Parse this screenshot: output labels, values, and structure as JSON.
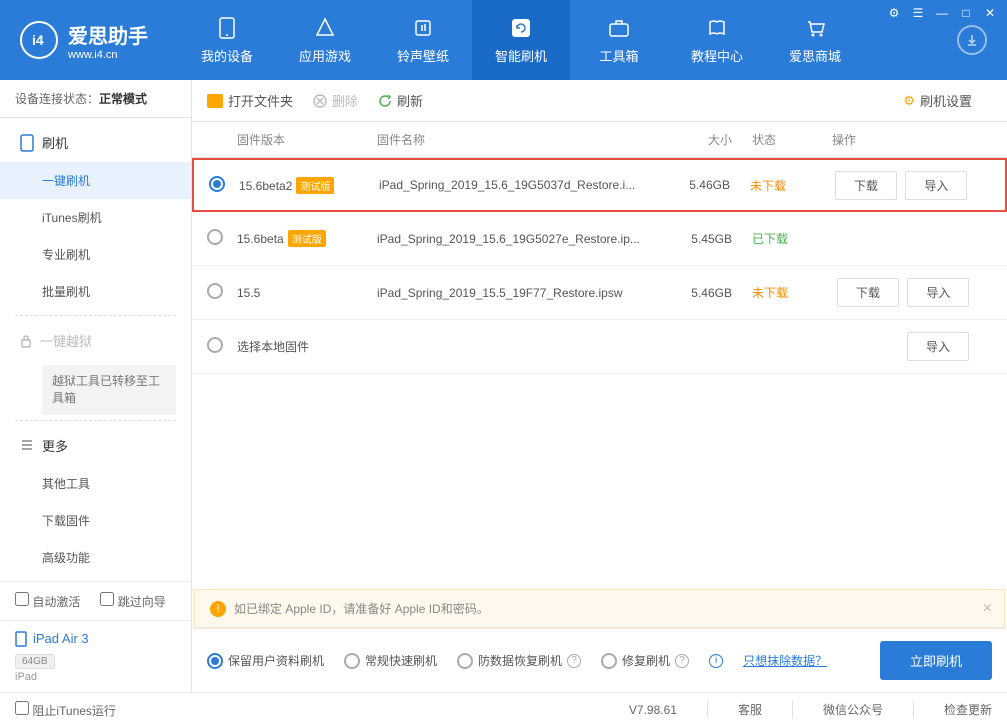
{
  "app": {
    "name": "爱思助手",
    "url": "www.i4.cn"
  },
  "nav": {
    "items": [
      {
        "label": "我的设备"
      },
      {
        "label": "应用游戏"
      },
      {
        "label": "铃声壁纸"
      },
      {
        "label": "智能刷机"
      },
      {
        "label": "工具箱"
      },
      {
        "label": "教程中心"
      },
      {
        "label": "爱思商城"
      }
    ]
  },
  "sidebar": {
    "status_label": "设备连接状态：",
    "status_value": "正常模式",
    "flash": "刷机",
    "items": {
      "oneclick": "一键刷机",
      "itunes": "iTunes刷机",
      "pro": "专业刷机",
      "batch": "批量刷机",
      "jailbreak": "一键越狱",
      "jailbreak_note": "越狱工具已转移至工具箱",
      "more": "更多",
      "other_tools": "其他工具",
      "download_fw": "下载固件",
      "advanced": "高级功能"
    },
    "auto_activate": "自动激活",
    "skip_guide": "跳过向导",
    "device": {
      "name": "iPad Air 3",
      "storage": "64GB",
      "model": "iPad"
    }
  },
  "toolbar": {
    "open_folder": "打开文件夹",
    "delete": "删除",
    "refresh": "刷新",
    "settings": "刷机设置"
  },
  "table": {
    "headers": {
      "version": "固件版本",
      "name": "固件名称",
      "size": "大小",
      "status": "状态",
      "action": "操作"
    },
    "rows": [
      {
        "version": "15.6beta2",
        "beta": "测试版",
        "name": "iPad_Spring_2019_15.6_19G5037d_Restore.i...",
        "size": "5.46GB",
        "status": "未下载",
        "status_class": "orange",
        "selected": true,
        "highlighted": true,
        "download": "下载",
        "import": "导入"
      },
      {
        "version": "15.6beta",
        "beta": "测试版",
        "name": "iPad_Spring_2019_15.6_19G5027e_Restore.ip...",
        "size": "5.45GB",
        "status": "已下载",
        "status_class": "green",
        "selected": false
      },
      {
        "version": "15.5",
        "name": "iPad_Spring_2019_15.5_19F77_Restore.ipsw",
        "size": "5.46GB",
        "status": "未下载",
        "status_class": "orange",
        "selected": false,
        "download": "下载",
        "import": "导入"
      },
      {
        "version": "",
        "name_alt": "选择本地固件",
        "import": "导入"
      }
    ]
  },
  "notice": "如已绑定 Apple ID，请准备好 Apple ID和密码。",
  "options": {
    "keep_data": "保留用户资料刷机",
    "normal": "常规快速刷机",
    "anti_loss": "防数据恢复刷机",
    "repair": "修复刷机",
    "erase": "只想抹除数据？",
    "flash_btn": "立即刷机"
  },
  "footer": {
    "block_itunes": "阻止iTunes运行",
    "version": "V7.98.61",
    "service": "客服",
    "wechat": "微信公众号",
    "check_update": "检查更新"
  }
}
